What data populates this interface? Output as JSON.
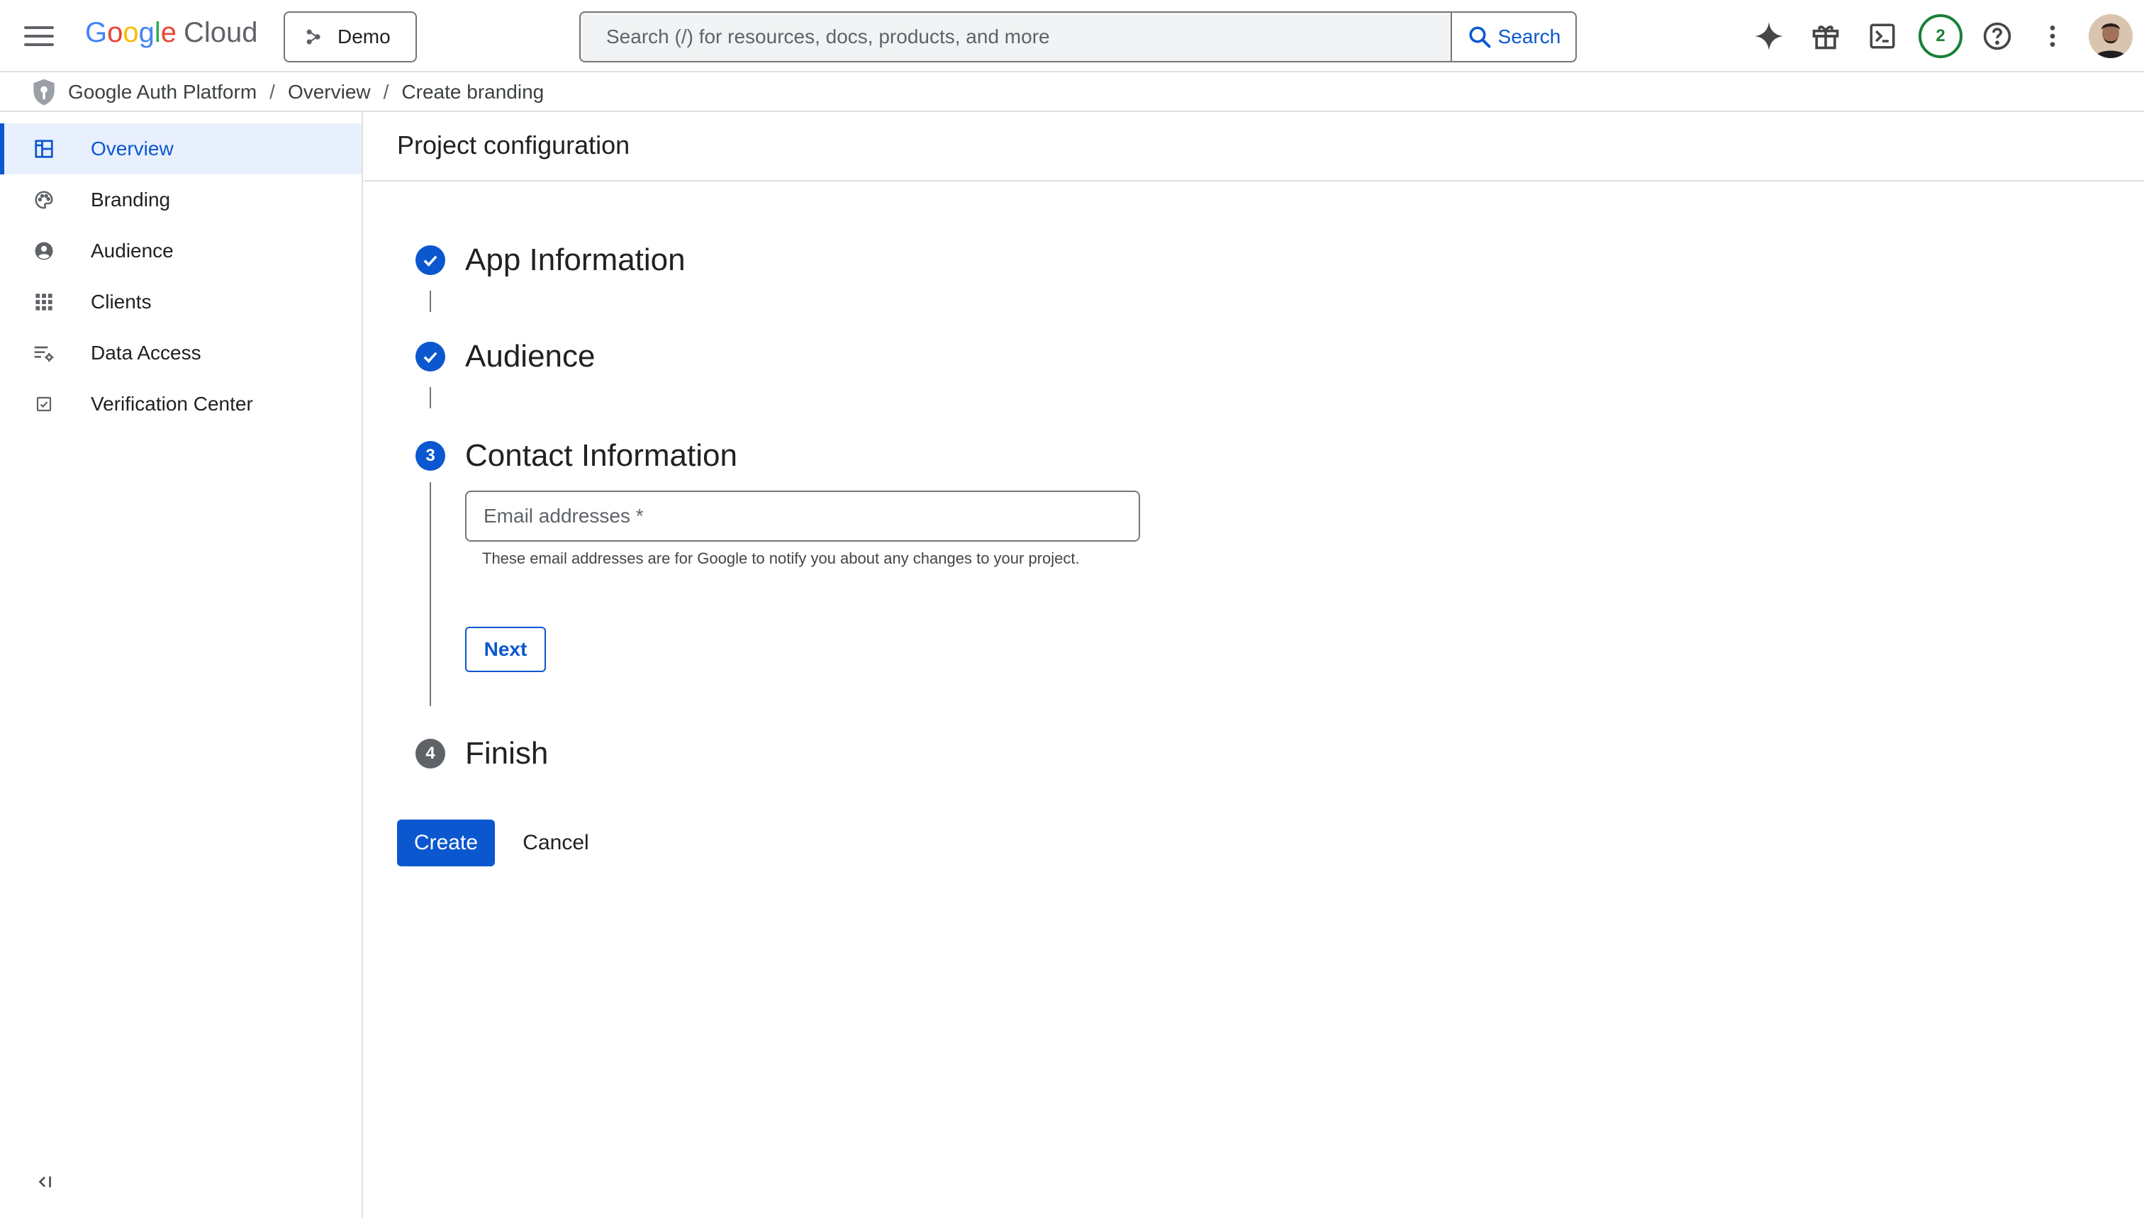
{
  "header": {
    "logo_google": [
      "G",
      "o",
      "o",
      "g",
      "l",
      "e"
    ],
    "logo_google_colors": [
      "#4285F4",
      "#EA4335",
      "#FBBC05",
      "#4285F4",
      "#34A853",
      "#EA4335"
    ],
    "logo_cloud": "Cloud",
    "project_label": "Demo",
    "search_placeholder": "Search (/) for resources, docs, products, and more",
    "search_button_label": "Search",
    "notification_count": "2",
    "icons": [
      "gemini-sparkle-icon",
      "gift-icon",
      "cloud-shell-icon",
      "help-icon",
      "more-vert-icon"
    ]
  },
  "breadcrumb": {
    "items": [
      "Google Auth Platform",
      "Overview",
      "Create branding"
    ],
    "separator": "/"
  },
  "sidebar": {
    "items": [
      {
        "label": "Overview",
        "icon": "dashboard-icon",
        "active": true
      },
      {
        "label": "Branding",
        "icon": "palette-icon",
        "active": false
      },
      {
        "label": "Audience",
        "icon": "account-circle-icon",
        "active": false
      },
      {
        "label": "Clients",
        "icon": "apps-grid-icon",
        "active": false
      },
      {
        "label": "Data Access",
        "icon": "data-settings-icon",
        "active": false
      },
      {
        "label": "Verification Center",
        "icon": "checkbox-icon",
        "active": false
      }
    ]
  },
  "main": {
    "title": "Project configuration",
    "steps": [
      {
        "title": "App Information",
        "state": "done"
      },
      {
        "title": "Audience",
        "state": "done"
      },
      {
        "number": "3",
        "title": "Contact Information",
        "state": "current"
      },
      {
        "number": "4",
        "title": "Finish",
        "state": "pending"
      }
    ],
    "email_field": {
      "placeholder": "Email addresses *",
      "value": "",
      "hint": "These email addresses are for Google to notify you about any changes to your project."
    },
    "next_label": "Next",
    "create_label": "Create",
    "cancel_label": "Cancel"
  },
  "colors": {
    "accent": "#0b57d0",
    "active_bg": "#e8f0fe",
    "badge": "#188038"
  }
}
